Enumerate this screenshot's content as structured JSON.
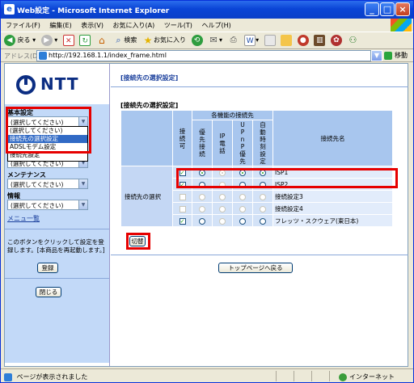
{
  "window": {
    "title": "Web設定 - Microsoft Internet Explorer",
    "title_icon": "ie-icon",
    "controls": [
      "_",
      "□",
      "×"
    ]
  },
  "menubar": [
    "ファイル(F)",
    "編集(E)",
    "表示(V)",
    "お気に入り(A)",
    "ツール(T)",
    "ヘルプ(H)"
  ],
  "toolbar": {
    "back_label": "戻る",
    "search_label": "検索",
    "favorites_label": "お気に入り"
  },
  "address": {
    "label": "アドレス(D)",
    "url": "http://192.168.1.1/index_frame.html",
    "go_label": "移動"
  },
  "sidebar": {
    "logo": "NTT",
    "sections": [
      {
        "heading": "基本設定",
        "selected": "(選択してください)"
      },
      {
        "heading": "メンテナンス",
        "selected": "(選択してください)"
      },
      {
        "heading": "情報",
        "selected": "(選択してください)"
      }
    ],
    "dropdown_options": [
      "(選択してください)",
      "接続先の選択設定",
      "ADSLモデム設定",
      "接続先設定"
    ],
    "highlighted_option_index": 1,
    "extra_select": "(選択してください)",
    "menu_list_link": "メニュ一覧",
    "note": "このボタンをクリックして設定を登録します。[本商品を再起動します。]",
    "register_button": "登録",
    "close_button": "閉じる"
  },
  "main": {
    "page_heading": "[接続先の選択設定]",
    "table_heading": "[接続先の選択設定]",
    "group_header": "各機能の接続先",
    "columns": [
      "接続可",
      "優先接続",
      "IP電話",
      "UPnP優先",
      "自動時刻設定",
      "接続先名"
    ],
    "row_label": "接続先の選択",
    "rows": [
      {
        "name": "ISP1",
        "connect": true,
        "connect_enabled": true,
        "priority": true,
        "ip_phone": false,
        "upnp": true,
        "auto_time": true
      },
      {
        "name": "ISP2",
        "connect": true,
        "connect_enabled": true,
        "priority": false,
        "ip_phone": false,
        "upnp": false,
        "auto_time": false
      },
      {
        "name": "接続設定3",
        "connect": false,
        "connect_enabled": false,
        "priority": false,
        "ip_phone": false,
        "upnp": false,
        "auto_time": false
      },
      {
        "name": "接続設定4",
        "connect": false,
        "connect_enabled": false,
        "priority": false,
        "ip_phone": false,
        "upnp": false,
        "auto_time": false
      },
      {
        "name": "フレッツ・スクウェア(東日本)",
        "connect": true,
        "connect_enabled": true,
        "priority": false,
        "ip_phone": false,
        "upnp": false,
        "auto_time": false
      }
    ],
    "switch_button": "切替",
    "top_page_button": "トップページへ戻る"
  },
  "status": {
    "message": "ページが表示されました",
    "zone": "インターネット"
  },
  "colors": {
    "highlight_red": "#e60000",
    "title_blue": "#0a45d6",
    "table_blue": "#d3e2f7",
    "sidebar_blue": "#c2d9f8"
  }
}
